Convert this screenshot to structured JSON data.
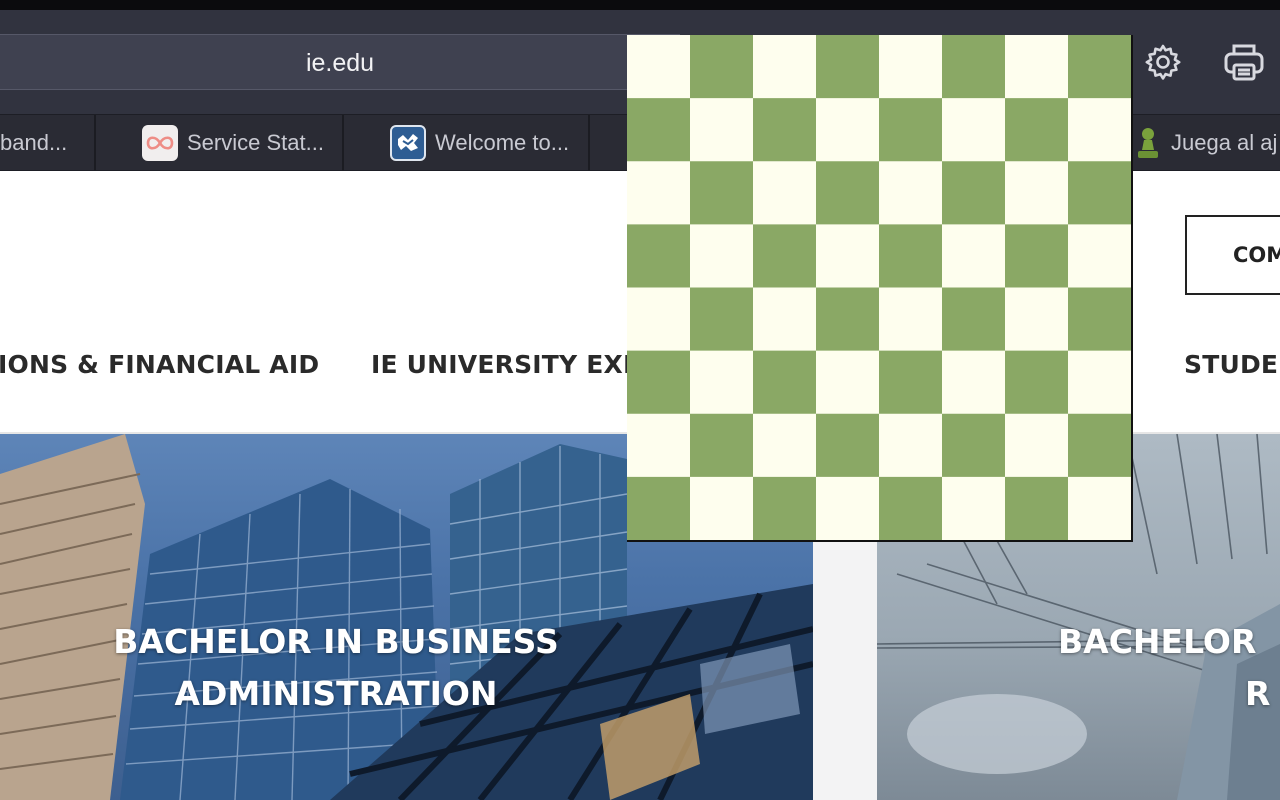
{
  "browser": {
    "url": "ie.edu",
    "toolbar_icons": [
      "gear-icon",
      "printer-icon"
    ],
    "tabs": [
      {
        "label": "band...",
        "icon": "none"
      },
      {
        "label": "Service Stat...",
        "icon": "infinity-logo-icon"
      },
      {
        "label": "Welcome to...",
        "icon": "welcome-logo-icon"
      },
      {
        "label": "Juega al aj",
        "icon": "chess-pawn-icon"
      }
    ]
  },
  "page": {
    "contact_button": "COM",
    "nav": [
      "IONS & FINANCIAL AID",
      "IE UNIVERSITY EXP",
      "STUDEN"
    ],
    "cards": [
      {
        "title_line1": "BACHELOR IN BUSINESS",
        "title_line2": "ADMINISTRATION"
      },
      {
        "title_line1": "BACHELOR",
        "title_line2": "R"
      }
    ]
  },
  "chessboard": {
    "rows": 8,
    "cols": 8,
    "light_color": "#fefeee",
    "dark_color": "#8aa865"
  }
}
